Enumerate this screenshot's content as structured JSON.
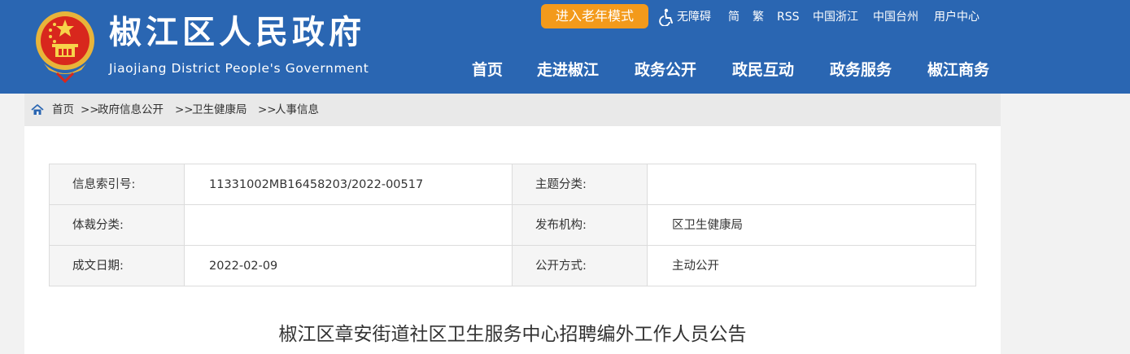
{
  "header": {
    "title": "椒江区人民政府",
    "subtitle": "Jiaojiang District People's Government",
    "elder_mode": "进入老年模式",
    "accessibility": "无障碍",
    "simplified": "简",
    "traditional": "繁",
    "rss": "RSS",
    "zhejiang": "中国浙江",
    "taizhou": "中国台州",
    "user_center": "用户中心",
    "colors": {
      "bar": "#2a66b2",
      "accent": "#f39a1b"
    }
  },
  "nav": [
    "首页",
    "走进椒江",
    "政务公开",
    "政民互动",
    "政务服务",
    "椒江商务"
  ],
  "breadcrumb": {
    "home": "首页",
    "sep": ">>",
    "items": [
      "政府信息公开",
      "卫生健康局",
      "人事信息"
    ]
  },
  "info": {
    "index_label": "信息索引号:",
    "index_value": "11331002MB16458203/2022-00517",
    "topic_label": "主题分类:",
    "topic_value": "",
    "genre_label": "体裁分类:",
    "genre_value": "",
    "publisher_label": "发布机构:",
    "publisher_value": "区卫生健康局",
    "date_label": "成文日期:",
    "date_value": "2022-02-09",
    "mode_label": "公开方式:",
    "mode_value": "主动公开"
  },
  "article": {
    "title": "椒江区章安街道社区卫生服务中心招聘编外工作人员公告"
  }
}
